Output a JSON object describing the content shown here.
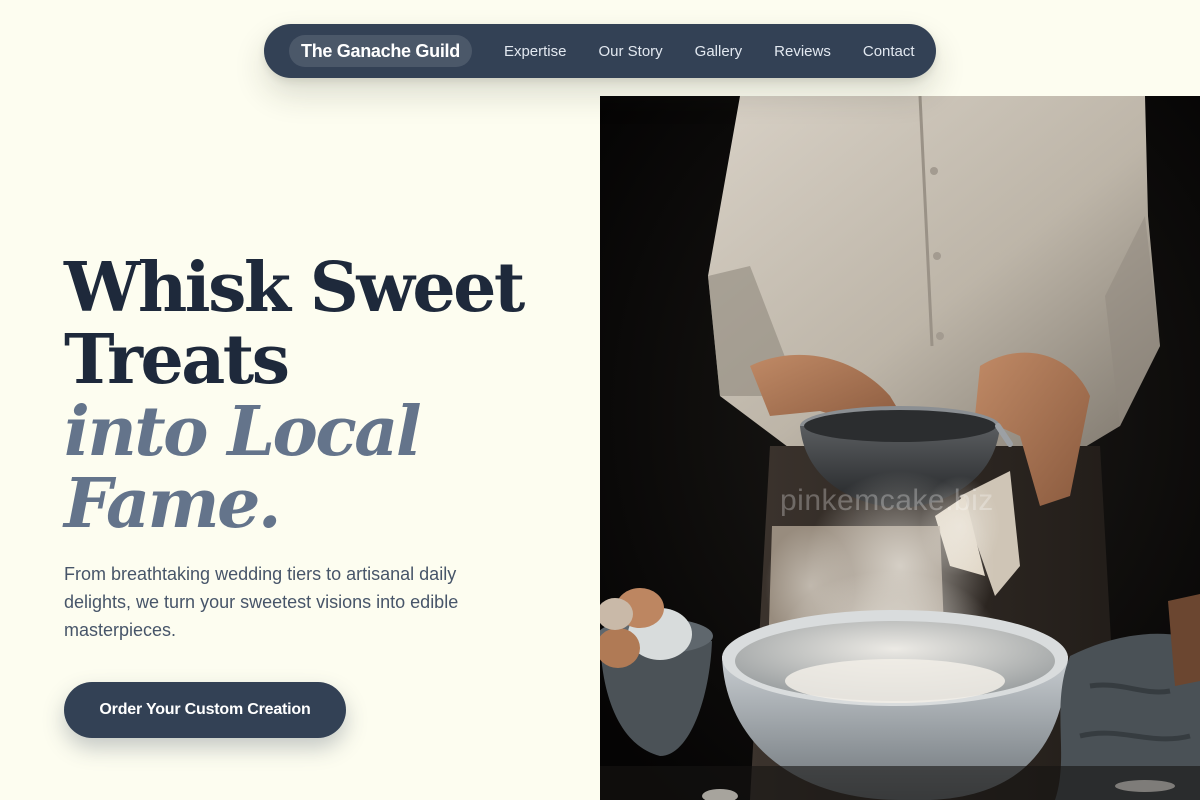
{
  "nav": {
    "brand": "The Ganache Guild",
    "links": [
      {
        "label": "Expertise"
      },
      {
        "label": "Our Story"
      },
      {
        "label": "Gallery"
      },
      {
        "label": "Reviews"
      },
      {
        "label": "Contact"
      }
    ]
  },
  "hero": {
    "headline_line1": "Whisk Sweet",
    "headline_line2": "Treats",
    "headline_line3": "into Local",
    "headline_line4": "Fame.",
    "subtext": "From breathtaking wedding tiers to artisanal daily delights, we turn your sweetest visions into edible masterpieces.",
    "cta_label": "Order Your Custom Creation"
  },
  "photo": {
    "watermark": "pinkemcake.biz"
  },
  "colors": {
    "page_background": "#fdfdf0",
    "primary": "#334155",
    "headline_dark": "#1e293b",
    "headline_accent": "#64748b",
    "body_text": "#475569"
  }
}
